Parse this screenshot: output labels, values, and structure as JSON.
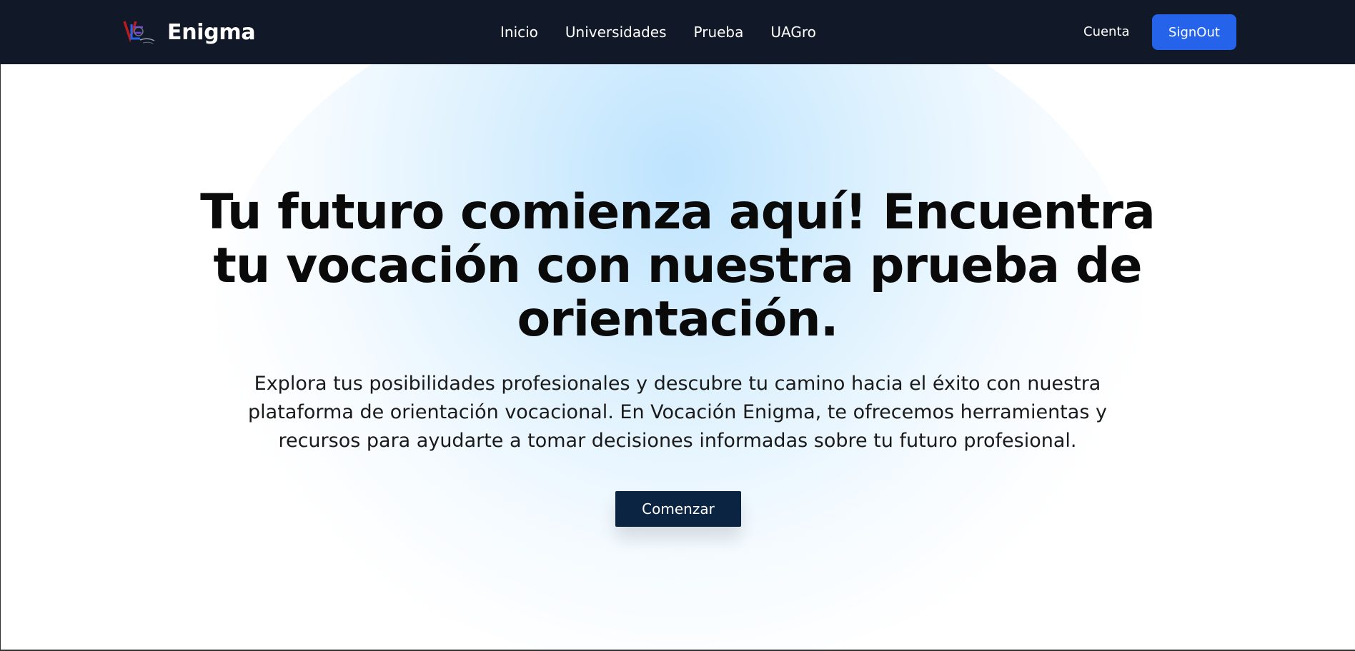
{
  "navbar": {
    "brand": "Enigma",
    "links": [
      {
        "label": "Inicio"
      },
      {
        "label": "Universidades"
      },
      {
        "label": "Prueba"
      },
      {
        "label": "UAGro"
      }
    ],
    "account_label": "Cuenta",
    "signout_label": "SignOut"
  },
  "hero": {
    "headline": "Tu futuro comienza aquí! Encuentra tu vocación con nuestra prueba de orientación.",
    "subtitle": "Explora tus posibilidades profesionales y descubre tu camino hacia el éxito con nuestra plataforma de orientación vocacional. En Vocación Enigma, te ofrecemos herramientas y recursos para ayudarte a tomar decisiones informadas sobre tu futuro profesional.",
    "cta_label": "Comenzar"
  },
  "colors": {
    "navbar_bg": "#111827",
    "signout_bg": "#2563eb",
    "cta_bg": "#0b2442",
    "glow": "#bae2fe"
  },
  "icons": {
    "logo": "brand-logo-icon"
  }
}
